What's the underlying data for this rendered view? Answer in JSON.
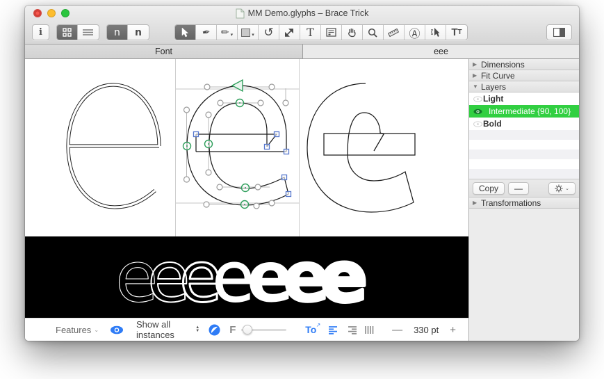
{
  "window": {
    "title": "MM Demo.glyphs – Brace Trick"
  },
  "tabs": [
    {
      "label": "Font"
    },
    {
      "label": "eee"
    }
  ],
  "toolbar": {
    "info_glyph": "i",
    "n_outline_glyph": "n",
    "n_solid_glyph": "n",
    "pen_glyph": "✒",
    "pencil_glyph": "✏",
    "rotate_glyph": "↺",
    "text_glyph": "T",
    "circle_a_glyph": "Ⓐ",
    "tt_glyph": "T",
    "tt_small_glyph": "T"
  },
  "sidebar": {
    "panels": {
      "dimensions": "Dimensions",
      "fit_curve": "Fit Curve",
      "layers": "Layers",
      "transformations": "Transformations"
    },
    "layers": [
      {
        "name": "Light",
        "selected": false
      },
      {
        "name": "Intermediate {90, 100}",
        "selected": true
      },
      {
        "name": "Bold",
        "selected": false
      }
    ],
    "copy_label": "Copy",
    "remove_label": "—"
  },
  "bottom_bar": {
    "features_label": "Features",
    "instances_label": "Show all instances",
    "f_label": "F",
    "kerning_label": "To",
    "zoom_out_label": "—",
    "zoom_value": "330 pt",
    "zoom_in_label": "+"
  },
  "preview": {
    "text": "eeeeeee",
    "glyphs": [
      "e",
      "e",
      "e",
      "e",
      "e",
      "e",
      "e"
    ]
  },
  "icons": {
    "disclosure_collapsed": "▶",
    "disclosure_expanded": "▼",
    "chevron_down": "⌄",
    "stepper_up": "▲",
    "stepper_down": "▼",
    "to_arrow": "↗"
  },
  "colors": {
    "selected_layer_green": "#31cf41",
    "accent_blue": "#2f7cf6",
    "node_green": "#2e9e5b",
    "node_blue": "#5577cc"
  }
}
